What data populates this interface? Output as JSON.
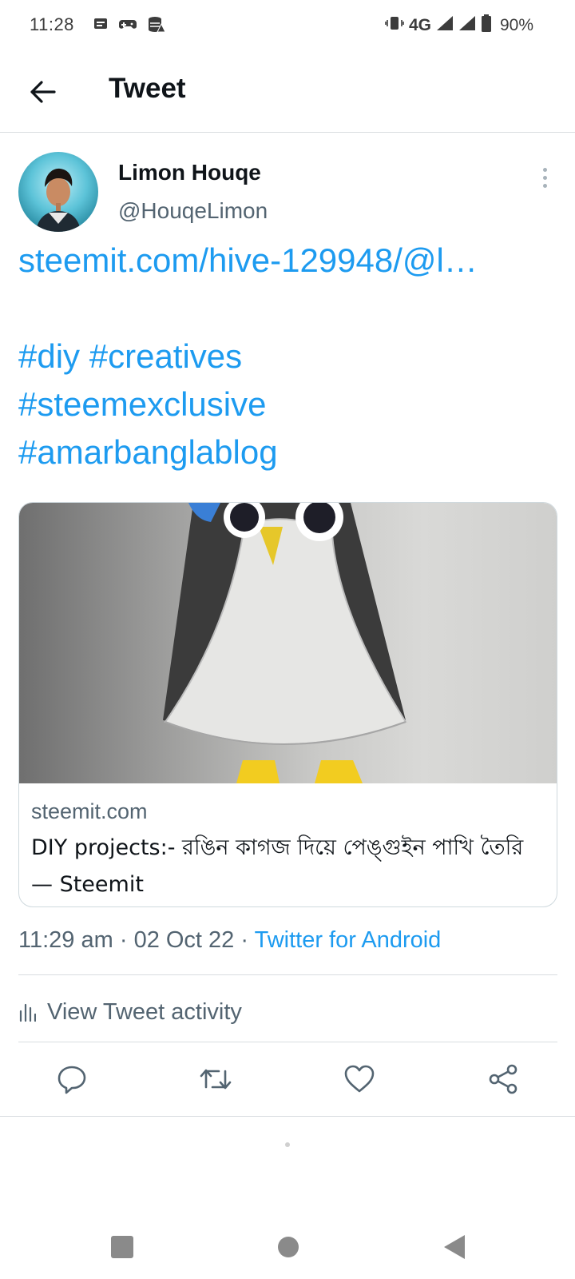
{
  "status_bar": {
    "time": "11:28",
    "network": "4G",
    "battery": "90%"
  },
  "app_bar": {
    "title": "Tweet"
  },
  "tweet": {
    "author_name": "Limon Houqe",
    "author_handle": "@HouqeLimon",
    "link_text": "steemit.com/hive-129948/@l…",
    "hashtags": [
      "#diy",
      "#creatives",
      "#steemexclusive",
      "#amarbanglablog"
    ],
    "card": {
      "domain": "steemit.com",
      "title": "DIY projects:- রঙিন কাগজ দিয়ে পেঙ্গুইন পাখি তৈরি — Steemit"
    },
    "time": "11:29 am",
    "date": "02 Oct 22",
    "separator": "·",
    "source": "Twitter for Android",
    "activity_label": "View Tweet activity"
  },
  "colors": {
    "accent": "#1d9bf0",
    "secondary_text": "#536471",
    "divider": "#d9dde0"
  },
  "icons": {
    "back": "arrow-left-icon",
    "more": "more-vertical-icon",
    "activity": "bar-chart-icon",
    "reply": "reply-icon",
    "retweet": "retweet-icon",
    "like": "heart-icon",
    "share": "share-icon"
  }
}
